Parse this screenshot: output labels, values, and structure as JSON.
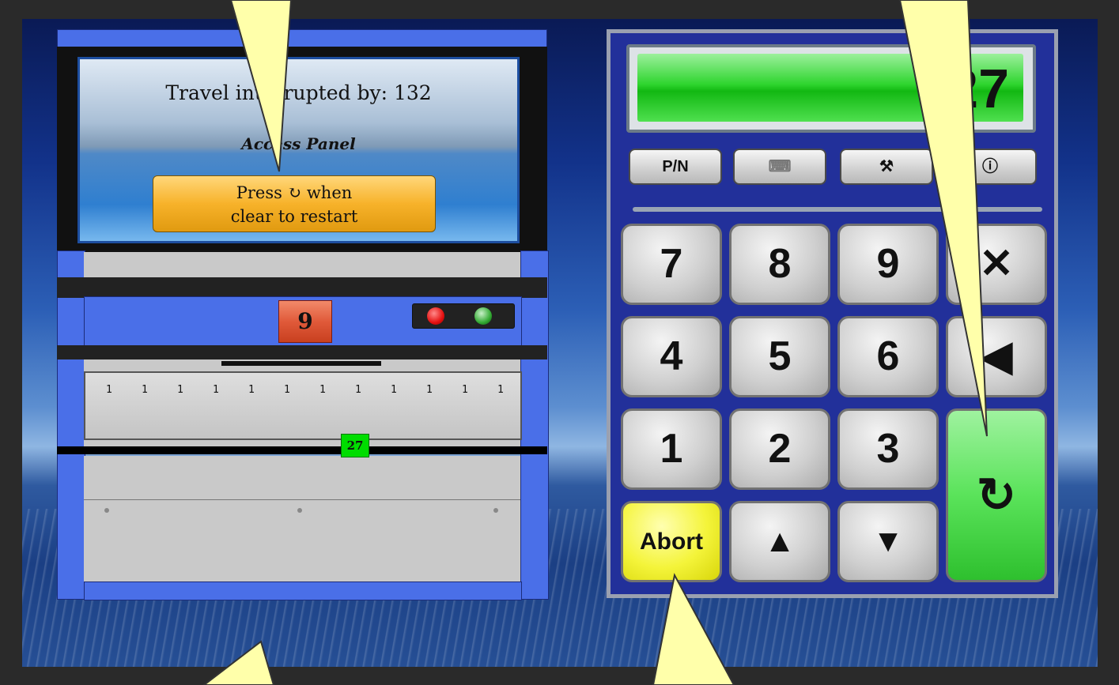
{
  "message_panel": {
    "title": "Travel interrupted by: 132",
    "subtitle": "Access Panel",
    "restart_line1": "Press ↻ when",
    "restart_line2": "clear to restart"
  },
  "counter_display": "9",
  "status_lights": {
    "red": "#e51010",
    "green": "#33aa33"
  },
  "ruler": {
    "ticks": [
      "1",
      "1",
      "1",
      "1",
      "1",
      "1",
      "1",
      "1",
      "1",
      "1",
      "1",
      "1"
    ]
  },
  "position_marker": "27",
  "keypad": {
    "display_value": "627",
    "function_keys": {
      "pn": "P/N",
      "keyboard": "⌨",
      "tools": "⚒",
      "info": "ⓘ"
    },
    "keys": {
      "k7": "7",
      "k8": "8",
      "k9": "9",
      "clear": "✕",
      "k4": "4",
      "k5": "5",
      "k6": "6",
      "backspace": "◀",
      "k1": "1",
      "k2": "2",
      "k3": "3",
      "restart": "↻",
      "abort": "Abort",
      "up": "▲",
      "down": "▼"
    }
  },
  "colors": {
    "machine_blue": "#4a6fe8",
    "display_green": "#2fd52f",
    "abort_yellow": "#f4f43a",
    "callout_yellow": "#ffffaa"
  }
}
